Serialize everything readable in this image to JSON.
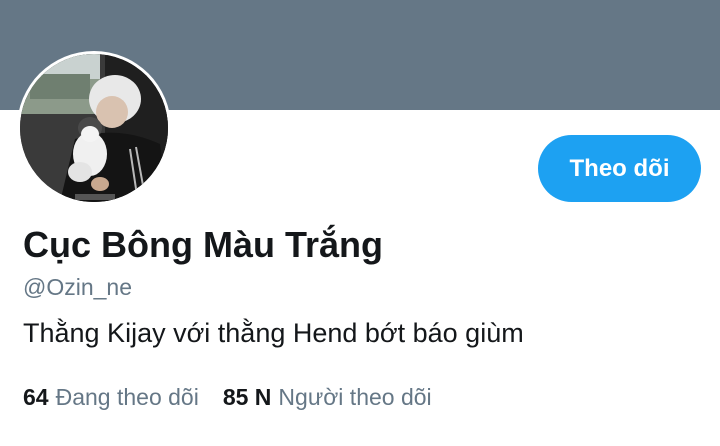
{
  "profile": {
    "display_name": "Cục Bông Màu Trắng",
    "handle": "@Ozin_ne",
    "bio": "Thằng Kijay với thằng Hend bớt báo giùm",
    "follow_button_label": "Theo dõi",
    "following_count": "64",
    "following_label": "Đang theo dõi",
    "followers_count": "85 N",
    "followers_label": "Người theo dõi"
  },
  "colors": {
    "banner": "#657786",
    "accent": "#1da1f2",
    "text_primary": "#14171a",
    "text_secondary": "#657786"
  }
}
